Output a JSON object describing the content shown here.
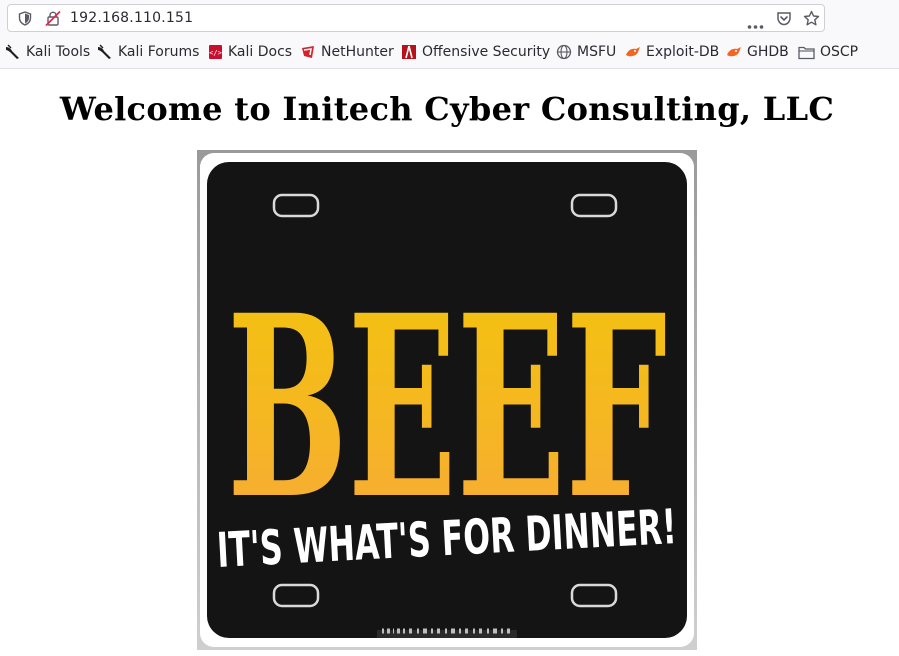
{
  "browser": {
    "url": "192.168.110.151",
    "bookmarks": [
      {
        "label": "Kali Tools",
        "icon": "kali-dragon-icon"
      },
      {
        "label": "Kali Forums",
        "icon": "kali-dragon-icon"
      },
      {
        "label": "Kali Docs",
        "icon": "kali-docs-icon"
      },
      {
        "label": "NetHunter",
        "icon": "nethunter-icon"
      },
      {
        "label": "Offensive Security",
        "icon": "offsec-icon"
      },
      {
        "label": "MSFU",
        "icon": "globe-icon"
      },
      {
        "label": "Exploit-DB",
        "icon": "exploit-db-icon"
      },
      {
        "label": "GHDB",
        "icon": "exploit-db-icon"
      },
      {
        "label": "OSCP",
        "icon": "folder-icon"
      }
    ]
  },
  "page": {
    "heading": "Welcome to Initech Cyber Consulting, LLC",
    "image": {
      "big_text": "BEEF",
      "tagline": "IT'S WHAT'S FOR DINNER!"
    }
  },
  "colors": {
    "plate_bg": "#141414",
    "beef_top": "#f2c40c",
    "beef_bottom": "#f7a83a"
  }
}
